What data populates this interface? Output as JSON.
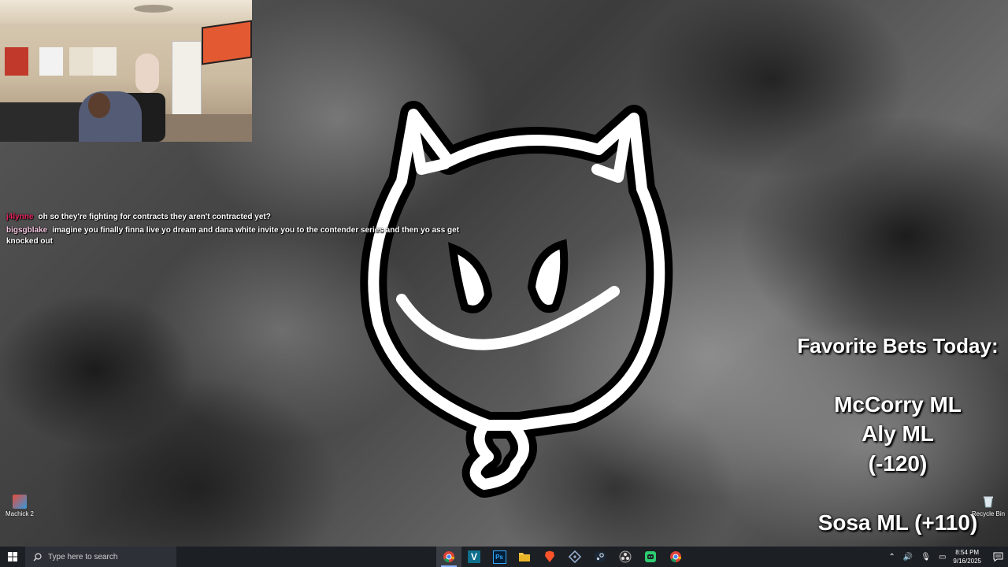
{
  "chat": {
    "messages": [
      {
        "user": "j4lynne",
        "user_color": "#e0245e",
        "text": "oh so they're fighting for contracts they aren't contracted yet?"
      },
      {
        "user": "bigsgblake",
        "user_color": "#f5c6e0",
        "text": "imagine you finally finna live yo dream and dana white invite you to the contender series and then yo ass get knocked out"
      }
    ]
  },
  "bets": {
    "title": "Favorite Bets Today:",
    "lines": [
      "McCorry ML",
      "Aly ML",
      "(-120)",
      "Sosa ML (+110)"
    ]
  },
  "desktop": {
    "icons": [
      {
        "label": "Machick 2",
        "icon": "game-icon"
      },
      {
        "label": "Recycle Bin",
        "icon": "recycle-bin-icon"
      }
    ]
  },
  "taskbar": {
    "search_placeholder": "Type here to search",
    "apps": [
      "chrome-icon",
      "vscode-icon",
      "photoshop-icon",
      "file-explorer-icon",
      "brave-icon",
      "git-icon",
      "steam-icon",
      "obs-icon",
      "discord-icon",
      "chrome-icon"
    ],
    "ps_label": "Ps",
    "v_label": "V",
    "time": "8:54 PM",
    "date": "9/16/2025"
  },
  "colors": {
    "taskbar": "#1c1f24",
    "accent": "#8ab4f8"
  }
}
